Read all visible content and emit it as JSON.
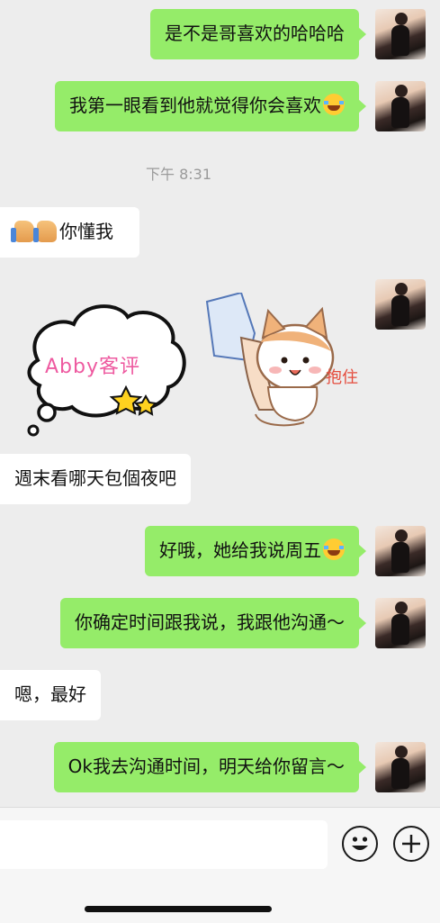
{
  "messages": [
    {
      "from": "me",
      "text": "是不是哥喜欢的哈哈哈"
    },
    {
      "from": "me",
      "text": "我第一眼看到他就觉得你会喜欢",
      "emoji": "laughing-tears-emoji"
    },
    {
      "from": "time",
      "text": "下午 8:31"
    },
    {
      "from": "them",
      "text": "你懂我",
      "prefix_emoji": "thumbs-up-emoji"
    },
    {
      "from": "them",
      "sticker": "Abby客评"
    },
    {
      "from": "me",
      "sticker_text": "抱住"
    },
    {
      "from": "them",
      "text": "週末看哪天包個夜吧"
    },
    {
      "from": "me",
      "text": "好哦，她给我说周五",
      "emoji": "laughing-tears-emoji"
    },
    {
      "from": "me",
      "text": "你确定时间跟我说，我跟他沟通～"
    },
    {
      "from": "them",
      "text": "嗯，最好"
    },
    {
      "from": "me",
      "text": "Ok我去沟通时间，明天给你留言～"
    }
  ],
  "colors": {
    "outgoing_bubble": "#95ec69",
    "incoming_bubble": "#ffffff",
    "chat_background": "#ededed",
    "abby_text": "#ee5aa0"
  },
  "input_bar": {
    "placeholder": "",
    "emoji_button_icon": "smiley-face-icon",
    "more_button_icon": "plus-icon"
  }
}
